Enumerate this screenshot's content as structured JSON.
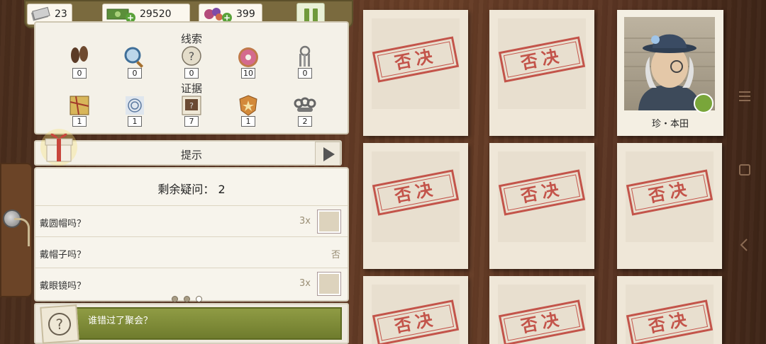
{
  "resources": {
    "tickets": "23",
    "cash": "29520",
    "candy": "399"
  },
  "clues": {
    "title": "线索",
    "items": [
      {
        "icon": "footprints-icon",
        "count": "0"
      },
      {
        "icon": "magnifier-icon",
        "count": "0"
      },
      {
        "icon": "question-bubble-icon",
        "count": "0"
      },
      {
        "icon": "donut-icon",
        "count": "10"
      },
      {
        "icon": "keys-icon",
        "count": "0"
      }
    ]
  },
  "evidence": {
    "title": "证据",
    "items": [
      {
        "icon": "map-icon",
        "count": "1"
      },
      {
        "icon": "fingerprint-icon",
        "count": "1"
      },
      {
        "icon": "photo-icon",
        "count": "7"
      },
      {
        "icon": "badge-icon",
        "count": "1"
      },
      {
        "icon": "brass-knuckles-icon",
        "count": "2"
      }
    ]
  },
  "hint": {
    "label": "提示"
  },
  "questions": {
    "remaining_label": "剩余疑问：",
    "remaining_count": "2",
    "rows": [
      {
        "text": "戴圆帽吗？",
        "value": "3x",
        "has_card": true
      },
      {
        "text": "戴帽子吗？",
        "value": "否",
        "has_card": false
      },
      {
        "text": "戴眼镜吗？",
        "value": "3x",
        "has_card": true
      }
    ]
  },
  "footer": {
    "question": "谁错过了聚会？"
  },
  "cards": {
    "rejected_stamp": "否决",
    "suspect_name": "珍・本田"
  },
  "colors": {
    "stamp_red": "#c0453c",
    "accent_green": "#6f9a3a"
  }
}
